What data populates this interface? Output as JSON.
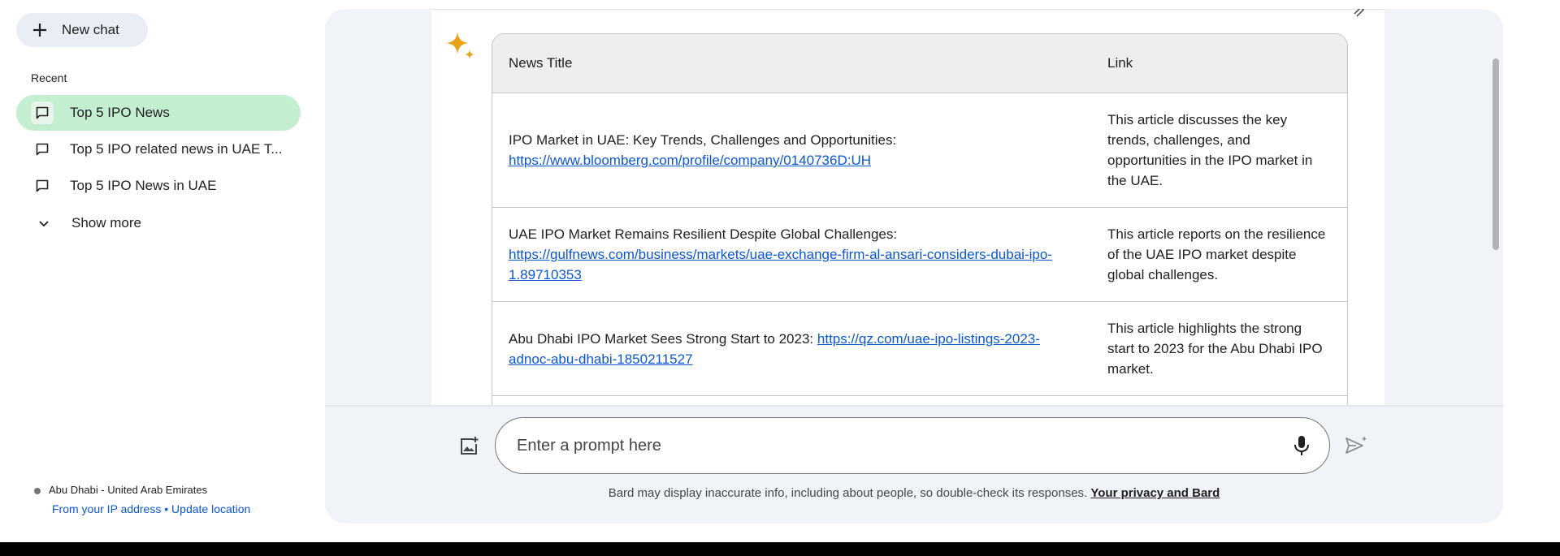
{
  "sidebar": {
    "new_chat_label": "New chat",
    "recent_title": "Recent",
    "items": [
      {
        "label": "Top 5 IPO News",
        "active": true
      },
      {
        "label": "Top 5 IPO related news in UAE T..."
      },
      {
        "label": "Top 5 IPO News in UAE"
      }
    ],
    "show_more_label": "Show more",
    "location": {
      "place": "Abu Dhabi - United Arab Emirates",
      "source_link": "From your IP address",
      "separator": "•",
      "update_link": "Update location"
    }
  },
  "table": {
    "headers": [
      "News Title",
      "Link"
    ],
    "rows": [
      {
        "title_prefix": "IPO Market in UAE: Key Trends, Challenges and Opportunities:",
        "url": "https://www.bloomberg.com/profile/company/0140736D:UH",
        "link_text": "This article discusses the key trends, challenges, and opportunities in the IPO market in the UAE."
      },
      {
        "title_prefix": "UAE IPO Market Remains Resilient Despite Global Challenges:",
        "url": "https://gulfnews.com/business/markets/uae-exchange-firm-al-ansari-considers-dubai-ipo-1.89710353",
        "link_text": "This article reports on the resilience of the UAE IPO market despite global challenges."
      },
      {
        "title_prefix": "Abu Dhabi IPO Market Sees Strong Start to 2023:",
        "url": "https://qz.com/uae-ipo-listings-2023-adnoc-abu-dhabi-1850211527",
        "link_text": "This article highlights the strong start to 2023 for the Abu Dhabi IPO market."
      }
    ]
  },
  "prompt": {
    "placeholder": "Enter a prompt here"
  },
  "disclaimer": {
    "text": "Bard may display inaccurate info, including about people, so double-check its responses.",
    "link": "Your privacy and Bard"
  },
  "icons": {
    "new_chat": "plus-icon",
    "chat_item": "chat-bubble-icon",
    "show_more": "chevron-down-icon",
    "response": "sparkle-icon",
    "image_upload": "image-add-icon",
    "mic": "microphone-icon",
    "send": "send-icon"
  },
  "colors": {
    "active_item": "#c4eed0",
    "panel_bg": "#f0f4f9",
    "link": "#0b57d0",
    "sparkle": "#e8a317"
  }
}
